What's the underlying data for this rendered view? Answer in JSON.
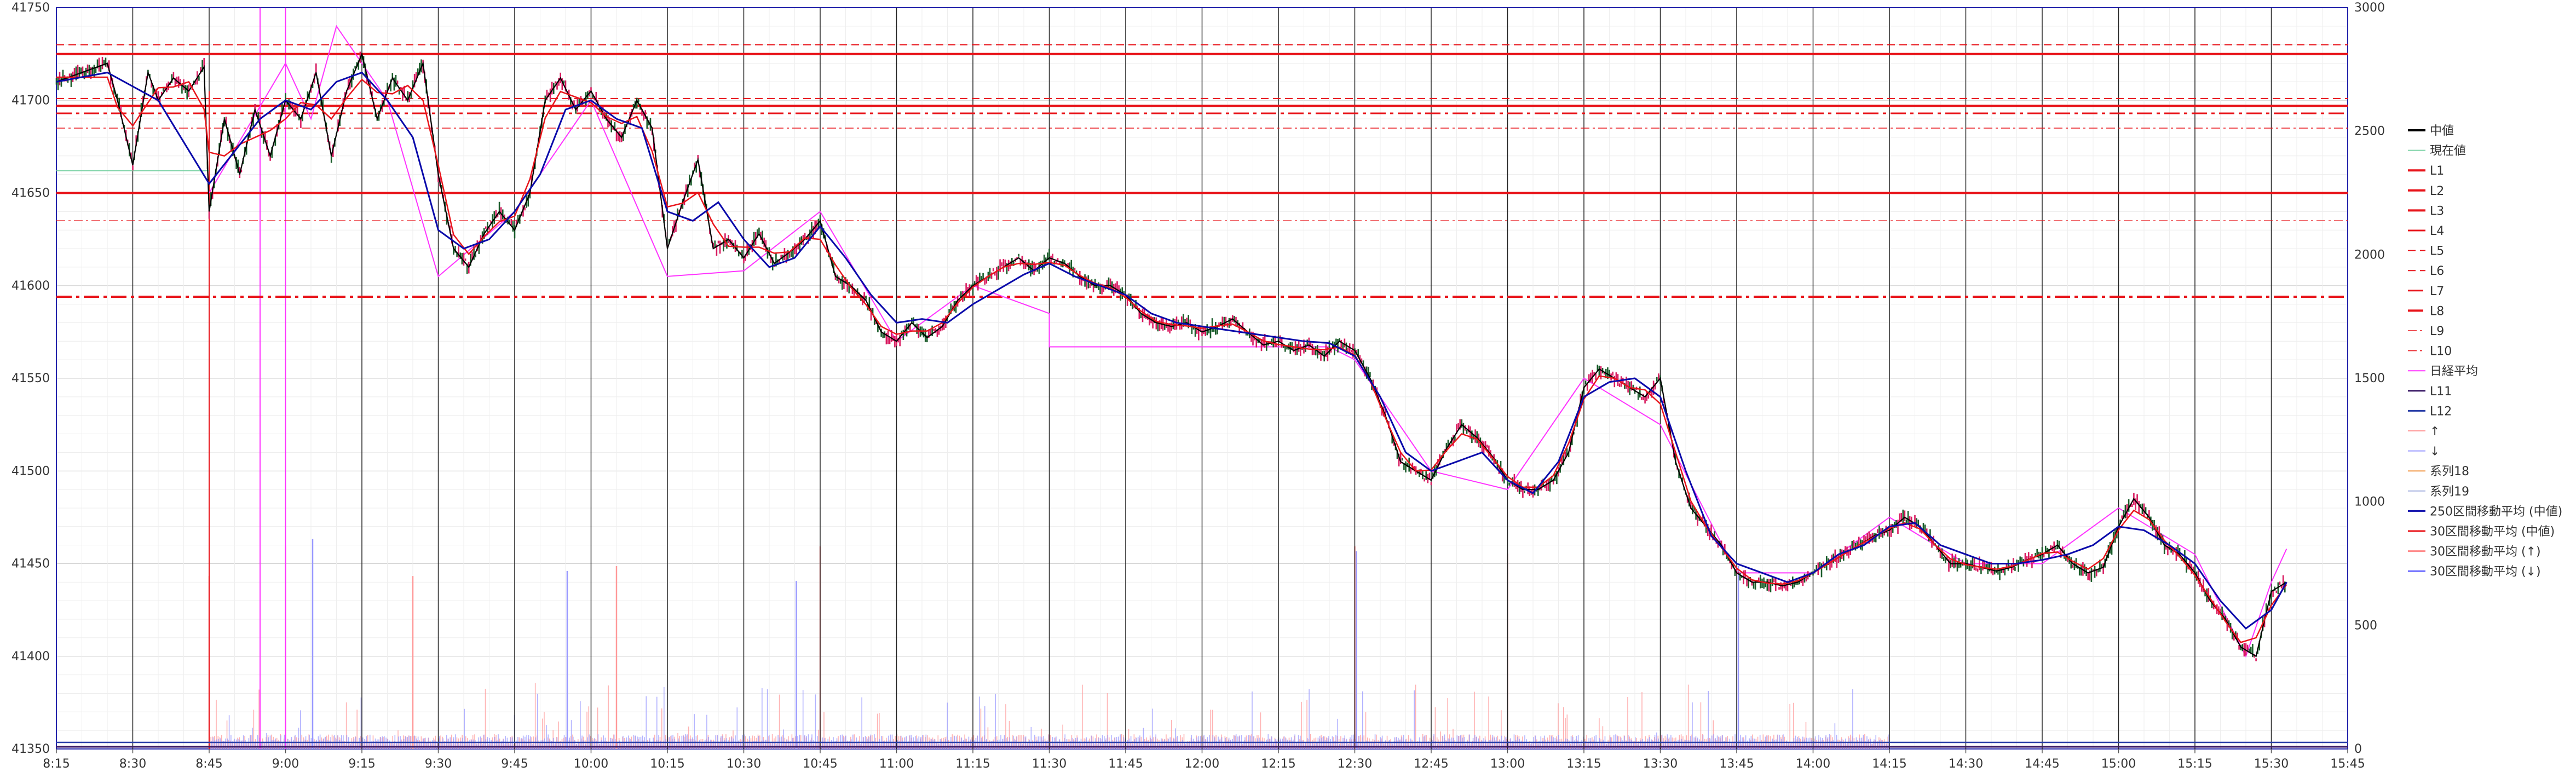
{
  "chart_data": {
    "type": "line",
    "title": "",
    "xlabel": "",
    "ylabel": "",
    "x_ticks": [
      "8:15",
      "8:30",
      "8:45",
      "9:00",
      "9:15",
      "9:30",
      "9:45",
      "10:00",
      "10:15",
      "10:30",
      "10:45",
      "11:00",
      "11:15",
      "11:30",
      "11:45",
      "12:00",
      "12:15",
      "12:30",
      "12:45",
      "13:00",
      "13:15",
      "13:30",
      "13:45",
      "14:00",
      "14:15",
      "14:30",
      "14:45",
      "15:00",
      "15:15",
      "15:30",
      "15:45"
    ],
    "x_range": [
      "8:15",
      "15:45"
    ],
    "ylim": [
      41350,
      41750
    ],
    "y_ticks": [
      41350,
      41400,
      41450,
      41500,
      41550,
      41600,
      41650,
      41700,
      41750
    ],
    "y2lim": [
      0,
      3000
    ],
    "y2_ticks": [
      0,
      500,
      1000,
      1500,
      2000,
      2500,
      3000
    ],
    "grid": true,
    "legend_position": "right",
    "colors": {
      "mid": "#000000",
      "candle_up": "#1a5c2a",
      "candle_down": "#d81b60",
      "current": "#7fd3a8",
      "level_red": "#e8141a",
      "nikkei_avg": "#ff33ff",
      "l11": "#3a1a66",
      "l12": "#2a3fa8",
      "up_volume": "#ff9999",
      "down_volume": "#9999ff",
      "ma250": "#0a0aaa",
      "ma30_mid": "#e8141a",
      "ma30_up": "#ff8a8a",
      "ma30_down": "#6b6bff",
      "series18": "#f29a4a",
      "series19": "#a8b4e0"
    },
    "levels": [
      {
        "name": "L1",
        "value": 41725,
        "style": "solid",
        "width": 4
      },
      {
        "name": "L2",
        "value": 41697,
        "style": "solid",
        "width": 4
      },
      {
        "name": "L3",
        "value": 41650,
        "style": "solid",
        "width": 4
      },
      {
        "name": "L4",
        "value": 41650,
        "style": "solid",
        "width": 2
      },
      {
        "name": "L5",
        "value": 41730,
        "style": "dash",
        "width": 2
      },
      {
        "name": "L6",
        "value": 41701,
        "style": "dash",
        "width": 2
      },
      {
        "name": "L7",
        "value": 41693,
        "style": "dashdot",
        "width": 3
      },
      {
        "name": "L8",
        "value": 41594,
        "style": "dashdot",
        "width": 4
      },
      {
        "name": "L9",
        "value": 41685,
        "style": "dashdot-thin",
        "width": 1.5
      },
      {
        "name": "L10",
        "value": 41635,
        "style": "dashdot-thin",
        "width": 1.5
      }
    ],
    "current_price": {
      "value": 41662,
      "from": "8:15",
      "to": "8:45"
    },
    "nikkei_avg": [
      {
        "x": "8:45",
        "y": 41650
      },
      {
        "x": "9:00",
        "y": 41720
      },
      {
        "x": "9:05",
        "y": 41690
      },
      {
        "x": "9:10",
        "y": 41740
      },
      {
        "x": "9:20",
        "y": 41700
      },
      {
        "x": "9:30",
        "y": 41605
      },
      {
        "x": "9:45",
        "y": 41640
      },
      {
        "x": "10:00",
        "y": 41700
      },
      {
        "x": "10:15",
        "y": 41605
      },
      {
        "x": "10:30",
        "y": 41608
      },
      {
        "x": "10:45",
        "y": 41640
      },
      {
        "x": "11:00",
        "y": 41570
      },
      {
        "x": "11:15",
        "y": 41600
      },
      {
        "x": "11:30",
        "y": 41585
      },
      {
        "x": "11:30",
        "y": 41567
      },
      {
        "x": "12:25",
        "y": 41567
      },
      {
        "x": "12:30",
        "y": 41560
      },
      {
        "x": "12:45",
        "y": 41500
      },
      {
        "x": "13:00",
        "y": 41490
      },
      {
        "x": "13:15",
        "y": 41550
      },
      {
        "x": "13:30",
        "y": 41525
      },
      {
        "x": "13:45",
        "y": 41445
      },
      {
        "x": "14:00",
        "y": 41445
      },
      {
        "x": "14:15",
        "y": 41475
      },
      {
        "x": "14:30",
        "y": 41450
      },
      {
        "x": "14:45",
        "y": 41450
      },
      {
        "x": "15:00",
        "y": 41480
      },
      {
        "x": "15:15",
        "y": 41455
      },
      {
        "x": "15:25",
        "y": 41400
      },
      {
        "x": "15:30",
        "y": 41440
      },
      {
        "x": "15:33",
        "y": 41458
      }
    ],
    "series": [
      {
        "name": "中値",
        "type": "line",
        "x": [
          "8:15",
          "8:25",
          "8:27",
          "8:30",
          "8:33",
          "8:35",
          "8:38",
          "8:41",
          "8:44",
          "8:45",
          "8:48",
          "8:51",
          "8:54",
          "8:57",
          "9:00",
          "9:03",
          "9:06",
          "9:09",
          "9:12",
          "9:15",
          "9:18",
          "9:21",
          "9:24",
          "9:27",
          "9:30",
          "9:33",
          "9:36",
          "9:39",
          "9:42",
          "9:45",
          "9:48",
          "9:51",
          "9:54",
          "9:57",
          "10:00",
          "10:03",
          "10:06",
          "10:09",
          "10:12",
          "10:15",
          "10:18",
          "10:21",
          "10:24",
          "10:27",
          "10:30",
          "10:33",
          "10:36",
          "10:39",
          "10:42",
          "10:45",
          "10:48",
          "10:51",
          "10:54",
          "10:57",
          "11:00",
          "11:03",
          "11:06",
          "11:09",
          "11:12",
          "11:15",
          "11:18",
          "11:21",
          "11:24",
          "11:27",
          "11:30",
          "11:33",
          "11:36",
          "11:39",
          "11:42",
          "11:45",
          "11:48",
          "11:51",
          "11:54",
          "11:57",
          "12:00",
          "12:03",
          "12:06",
          "12:09",
          "12:12",
          "12:15",
          "12:18",
          "12:21",
          "12:24",
          "12:27",
          "12:30",
          "12:33",
          "12:36",
          "12:39",
          "12:42",
          "12:45",
          "12:48",
          "12:51",
          "12:54",
          "12:57",
          "13:00",
          "13:03",
          "13:06",
          "13:09",
          "13:12",
          "13:15",
          "13:18",
          "13:21",
          "13:24",
          "13:27",
          "13:30",
          "13:33",
          "13:36",
          "13:39",
          "13:42",
          "13:45",
          "13:48",
          "13:51",
          "13:54",
          "13:57",
          "14:00",
          "14:03",
          "14:06",
          "14:09",
          "14:12",
          "14:15",
          "14:18",
          "14:21",
          "14:24",
          "14:27",
          "14:30",
          "14:33",
          "14:36",
          "14:39",
          "14:42",
          "14:45",
          "14:48",
          "14:51",
          "14:54",
          "14:57",
          "15:00",
          "15:03",
          "15:06",
          "15:09",
          "15:12",
          "15:15",
          "15:18",
          "15:21",
          "15:24",
          "15:27",
          "15:30",
          "15:33"
        ],
        "values": [
          41710,
          41720,
          41700,
          41665,
          41715,
          41700,
          41712,
          41705,
          41718,
          41640,
          41690,
          41660,
          41695,
          41670,
          41700,
          41690,
          41715,
          41670,
          41705,
          41725,
          41690,
          41712,
          41700,
          41720,
          41660,
          41620,
          41610,
          41628,
          41640,
          41630,
          41650,
          41700,
          41712,
          41695,
          41705,
          41690,
          41680,
          41700,
          41685,
          41620,
          41645,
          41668,
          41620,
          41625,
          41615,
          41628,
          41612,
          41618,
          41625,
          41635,
          41605,
          41600,
          41592,
          41575,
          41570,
          41580,
          41572,
          41578,
          41592,
          41600,
          41605,
          41610,
          41615,
          41608,
          41615,
          41612,
          41605,
          41600,
          41600,
          41595,
          41585,
          41580,
          41578,
          41580,
          41575,
          41578,
          41582,
          41575,
          41568,
          41570,
          41565,
          41568,
          41562,
          41570,
          41565,
          41550,
          41530,
          41505,
          41500,
          41495,
          41512,
          41525,
          41518,
          41508,
          41495,
          41490,
          41490,
          41495,
          41510,
          41545,
          41555,
          41550,
          41545,
          41540,
          41550,
          41505,
          41480,
          41470,
          41460,
          41445,
          41440,
          41440,
          41438,
          41440,
          41445,
          41450,
          41455,
          41460,
          41465,
          41468,
          41475,
          41470,
          41460,
          41450,
          41450,
          41448,
          41446,
          41448,
          41452,
          41455,
          41460,
          41450,
          41445,
          41448,
          41470,
          41485,
          41475,
          41460,
          41455,
          41445,
          41430,
          41420,
          41405,
          41400,
          41435,
          41440
        ]
      },
      {
        "name": "250区間移動平均(中値)",
        "type": "line",
        "x": [
          "8:15",
          "8:25",
          "8:35",
          "8:45",
          "8:55",
          "9:00",
          "9:05",
          "9:10",
          "9:15",
          "9:20",
          "9:25",
          "9:30",
          "9:35",
          "9:40",
          "9:45",
          "9:50",
          "9:55",
          "10:00",
          "10:05",
          "10:10",
          "10:15",
          "10:20",
          "10:25",
          "10:30",
          "10:35",
          "10:40",
          "10:45",
          "10:50",
          "10:55",
          "11:00",
          "11:05",
          "11:10",
          "11:15",
          "11:20",
          "11:25",
          "11:30",
          "11:35",
          "11:40",
          "11:45",
          "11:50",
          "11:55",
          "12:00",
          "12:05",
          "12:10",
          "12:15",
          "12:20",
          "12:25",
          "12:30",
          "12:35",
          "12:40",
          "12:45",
          "12:50",
          "12:55",
          "13:00",
          "13:05",
          "13:10",
          "13:15",
          "13:20",
          "13:25",
          "13:30",
          "13:35",
          "13:40",
          "13:45",
          "13:50",
          "13:55",
          "14:00",
          "14:05",
          "14:10",
          "14:15",
          "14:20",
          "14:25",
          "14:30",
          "14:35",
          "14:40",
          "14:45",
          "14:50",
          "14:55",
          "15:00",
          "15:05",
          "15:10",
          "15:15",
          "15:20",
          "15:25",
          "15:30",
          "15:33"
        ],
        "values": [
          41710,
          41715,
          41700,
          41655,
          41690,
          41700,
          41695,
          41710,
          41715,
          41700,
          41680,
          41630,
          41620,
          41625,
          41640,
          41660,
          41695,
          41700,
          41690,
          41685,
          41640,
          41635,
          41645,
          41625,
          41610,
          41615,
          41632,
          41615,
          41595,
          41580,
          41582,
          41580,
          41590,
          41598,
          41606,
          41612,
          41605,
          41600,
          41595,
          41585,
          41580,
          41578,
          41576,
          41574,
          41572,
          41570,
          41569,
          41562,
          41540,
          41510,
          41500,
          41505,
          41510,
          41495,
          41488,
          41505,
          41540,
          41548,
          41550,
          41540,
          41500,
          41465,
          41450,
          41445,
          41440,
          41445,
          41455,
          41460,
          41470,
          41472,
          41460,
          41455,
          41450,
          41450,
          41452,
          41455,
          41460,
          41470,
          41468,
          41460,
          41450,
          41430,
          41415,
          41425,
          41440
        ]
      }
    ],
    "volume": {
      "up_peaks": [
        {
          "x": "8:45",
          "y": 700
        },
        {
          "x": "9:00",
          "y": 820
        },
        {
          "x": "9:25",
          "y": 700
        },
        {
          "x": "10:05",
          "y": 740
        },
        {
          "x": "10:45",
          "y": 820
        },
        {
          "x": "12:30",
          "y": 820
        },
        {
          "x": "13:00",
          "y": 790
        }
      ],
      "down_peaks": [
        {
          "x": "9:05",
          "y": 850
        },
        {
          "x": "9:55",
          "y": 720
        },
        {
          "x": "10:40",
          "y": 680
        },
        {
          "x": "12:30",
          "y": 800
        },
        {
          "x": "13:45",
          "y": 740
        }
      ]
    }
  },
  "legend": {
    "items": [
      {
        "label": "中値",
        "color": "#000000",
        "style": "solid",
        "width": 4
      },
      {
        "label": "現在値",
        "color": "#7fd3a8",
        "style": "solid",
        "width": 2
      },
      {
        "label": "L1",
        "color": "#e8141a",
        "style": "solid",
        "width": 4
      },
      {
        "label": "L2",
        "color": "#e8141a",
        "style": "solid",
        "width": 4
      },
      {
        "label": "L3",
        "color": "#e8141a",
        "style": "solid",
        "width": 4
      },
      {
        "label": "L4",
        "color": "#e8141a",
        "style": "solid",
        "width": 3
      },
      {
        "label": "L5",
        "color": "#e8141a",
        "style": "dash",
        "width": 2
      },
      {
        "label": "L6",
        "color": "#e8141a",
        "style": "dash",
        "width": 2
      },
      {
        "label": "L7",
        "color": "#e8141a",
        "style": "dashdot",
        "width": 3
      },
      {
        "label": "L8",
        "color": "#e8141a",
        "style": "dashdot",
        "width": 4
      },
      {
        "label": "L9",
        "color": "#e8141a",
        "style": "dashdot-thin",
        "width": 1.5
      },
      {
        "label": "L10",
        "color": "#e8141a",
        "style": "dashdot-thin",
        "width": 1.5
      },
      {
        "label": "日経平均",
        "color": "#ff33ff",
        "style": "solid",
        "width": 2
      },
      {
        "label": "L11",
        "color": "#3a1a66",
        "style": "solid",
        "width": 3
      },
      {
        "label": "L12",
        "color": "#2a3fa8",
        "style": "solid",
        "width": 3
      },
      {
        "label": "↑",
        "color": "#ff9999",
        "style": "solid",
        "width": 2
      },
      {
        "label": "↓",
        "color": "#9999ff",
        "style": "solid",
        "width": 2
      },
      {
        "label": "系列18",
        "color": "#f29a4a",
        "style": "solid",
        "width": 2
      },
      {
        "label": "系列19",
        "color": "#a8b4e0",
        "style": "solid",
        "width": 2
      },
      {
        "label": "250区間移動平均 (中値)",
        "color": "#0a0aaa",
        "style": "solid",
        "width": 3
      },
      {
        "label": "30区間移動平均 (中値)",
        "color": "#e8141a",
        "style": "solid",
        "width": 3
      },
      {
        "label": "30区間移動平均 (↑)",
        "color": "#ff8a8a",
        "style": "solid",
        "width": 3
      },
      {
        "label": "30区間移動平均 (↓)",
        "color": "#6b6bff",
        "style": "solid",
        "width": 3
      }
    ]
  }
}
